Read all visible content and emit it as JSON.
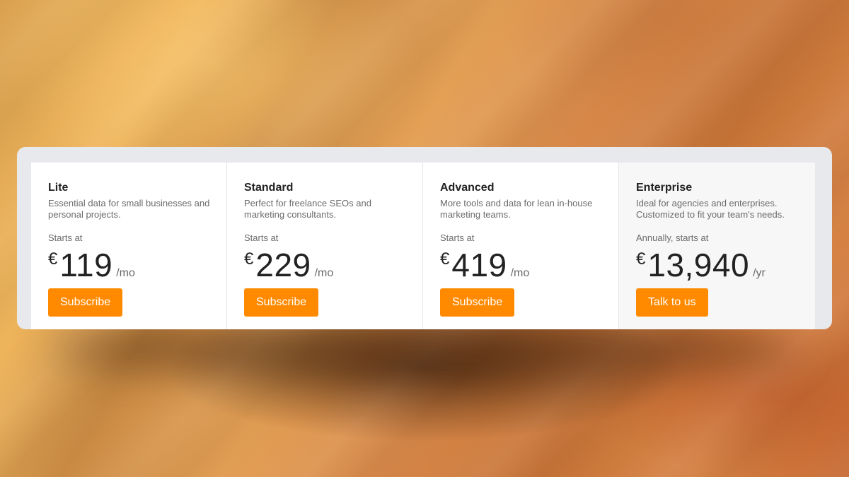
{
  "plans": [
    {
      "name": "Lite",
      "description": "Essential data for small businesses and personal projects.",
      "price_note": "Starts at",
      "currency": "€",
      "amount": "119",
      "period": "/mo",
      "cta_label": "Subscribe"
    },
    {
      "name": "Standard",
      "description": "Perfect for freelance SEOs and marketing consultants.",
      "price_note": "Starts at",
      "currency": "€",
      "amount": "229",
      "period": "/mo",
      "cta_label": "Subscribe"
    },
    {
      "name": "Advanced",
      "description": "More tools and data for lean in-house marketing teams.",
      "price_note": "Starts at",
      "currency": "€",
      "amount": "419",
      "period": "/mo",
      "cta_label": "Subscribe"
    },
    {
      "name": "Enterprise",
      "description": "Ideal for agencies and enterprises. Customized to fit your team's needs.",
      "price_note": "Annually, starts at",
      "currency": "€",
      "amount": "13,940",
      "period": "/yr",
      "cta_label": "Talk to us"
    }
  ],
  "colors": {
    "accent": "#ff8a00",
    "heading": "#222222",
    "muted": "#6b6b6b",
    "frame": "#e8e9ec"
  }
}
